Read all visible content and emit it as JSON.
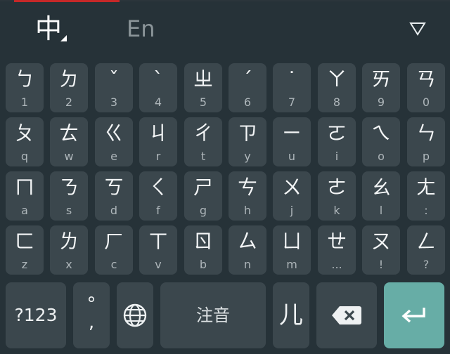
{
  "topbar": {
    "lang_zh": "中",
    "lang_en": "En",
    "hide_icon": "hide-keyboard-icon"
  },
  "rows": [
    [
      {
        "main": "ㄅ",
        "sub": "1"
      },
      {
        "main": "ㄉ",
        "sub": "2"
      },
      {
        "main": "ˇ",
        "sub": "3"
      },
      {
        "main": "ˋ",
        "sub": "4"
      },
      {
        "main": "ㄓ",
        "sub": "5"
      },
      {
        "main": "ˊ",
        "sub": "6"
      },
      {
        "main": "˙",
        "sub": "7"
      },
      {
        "main": "ㄚ",
        "sub": "8"
      },
      {
        "main": "ㄞ",
        "sub": "9"
      },
      {
        "main": "ㄢ",
        "sub": "0"
      }
    ],
    [
      {
        "main": "ㄆ",
        "sub": "q"
      },
      {
        "main": "ㄊ",
        "sub": "w"
      },
      {
        "main": "ㄍ",
        "sub": "e"
      },
      {
        "main": "ㄐ",
        "sub": "r"
      },
      {
        "main": "ㄔ",
        "sub": "t"
      },
      {
        "main": "ㄗ",
        "sub": "y"
      },
      {
        "main": "ㄧ",
        "sub": "u"
      },
      {
        "main": "ㄛ",
        "sub": "i"
      },
      {
        "main": "ㄟ",
        "sub": "o"
      },
      {
        "main": "ㄣ",
        "sub": "p"
      }
    ],
    [
      {
        "main": "ㄇ",
        "sub": "a"
      },
      {
        "main": "ㄋ",
        "sub": "s"
      },
      {
        "main": "ㄎ",
        "sub": "d"
      },
      {
        "main": "ㄑ",
        "sub": "f"
      },
      {
        "main": "ㄕ",
        "sub": "g"
      },
      {
        "main": "ㄘ",
        "sub": "h"
      },
      {
        "main": "ㄨ",
        "sub": "j"
      },
      {
        "main": "ㄜ",
        "sub": "k"
      },
      {
        "main": "ㄠ",
        "sub": "l"
      },
      {
        "main": "ㄤ",
        "sub": ":"
      }
    ],
    [
      {
        "main": "ㄈ",
        "sub": "z"
      },
      {
        "main": "ㄌ",
        "sub": "x"
      },
      {
        "main": "ㄏ",
        "sub": "c"
      },
      {
        "main": "ㄒ",
        "sub": "v"
      },
      {
        "main": "ㄖ",
        "sub": "b"
      },
      {
        "main": "ㄙ",
        "sub": "n"
      },
      {
        "main": "ㄩ",
        "sub": "m"
      },
      {
        "main": "ㄝ",
        "sub": "..."
      },
      {
        "main": "ㄡ",
        "sub": "!"
      },
      {
        "main": "ㄥ",
        "sub": "?"
      }
    ]
  ],
  "bottom": {
    "symbols_label": "?123",
    "punct_top": "°",
    "punct_bottom": ",",
    "globe_icon": "globe-icon",
    "space_label": "注音",
    "er_label": "儿",
    "backspace_icon": "backspace-icon",
    "enter_icon": "enter-icon"
  },
  "colors": {
    "background": "#263238",
    "key": "#3b474d",
    "enter": "#67ada6",
    "label": "#f3f5f6",
    "sublabel": "#aeb6ba",
    "inactive_lang": "#8b9599"
  }
}
